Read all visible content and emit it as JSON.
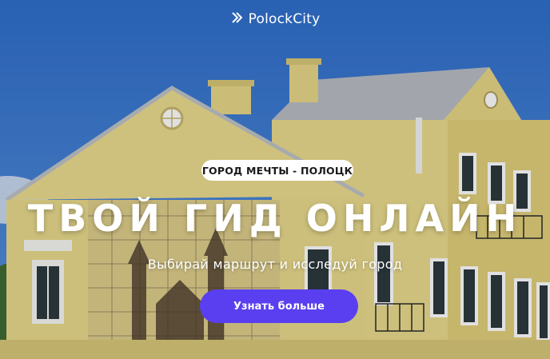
{
  "brand": {
    "name": "PolockCity",
    "logo_icon": "polockcity-logo-icon"
  },
  "hero": {
    "badge": "ГОРОД МЕЧТЫ - ПОЛОЦК",
    "title": "ТВОЙ ГИД ОНЛАЙН",
    "subtitle": "Выбирай маршрут и исследуй город",
    "cta_label": "Узнать больше"
  },
  "colors": {
    "sky": "#3a78d0",
    "building": "#e8d98a",
    "roof": "#b9bec4",
    "accent": "#5a3ff0",
    "text": "#ffffff"
  }
}
